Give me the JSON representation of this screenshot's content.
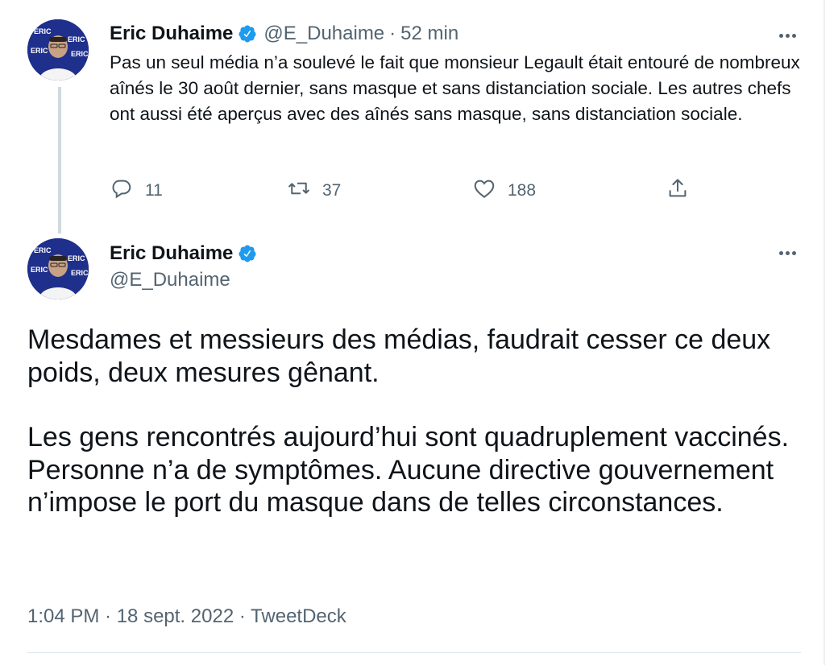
{
  "tweet1": {
    "author_name": "Eric Duhaime",
    "handle": "@E_Duhaime",
    "separator": "·",
    "time": "52 min",
    "text": "Pas un seul média n’a soulevé le fait que monsieur Legault était entouré de nombreux aînés le 30 août dernier, sans masque et sans distanciation sociale. Les autres chefs ont aussi été aperçus avec des aînés sans masque, sans distanciation sociale.",
    "replies": "11",
    "retweets": "37",
    "likes": "188"
  },
  "tweet2": {
    "author_name": "Eric Duhaime",
    "handle": "@E_Duhaime",
    "paragraph1": "Mesdames et messieurs des médias, faudrait cesser ce deux poids, deux mesures gênant.",
    "paragraph2": "Les gens rencontrés aujourd’hui sont quadruplement vaccinés. Personne n’a de symptômes. Aucune directive gouvernement n’impose le port du masque dans de telles circonstances.",
    "timestamp": "1:04 PM · 18 sept. 2022 · TweetDeck"
  },
  "icons": {
    "verified": "verified-badge-icon",
    "reply": "reply-icon",
    "retweet": "retweet-icon",
    "like": "heart-icon",
    "share": "share-icon",
    "more": "more-dots-icon"
  },
  "colors": {
    "verified_blue": "#1d9bf0",
    "secondary_text": "#536471",
    "primary_text": "#0f1419",
    "thread_line": "#cfd9de"
  }
}
